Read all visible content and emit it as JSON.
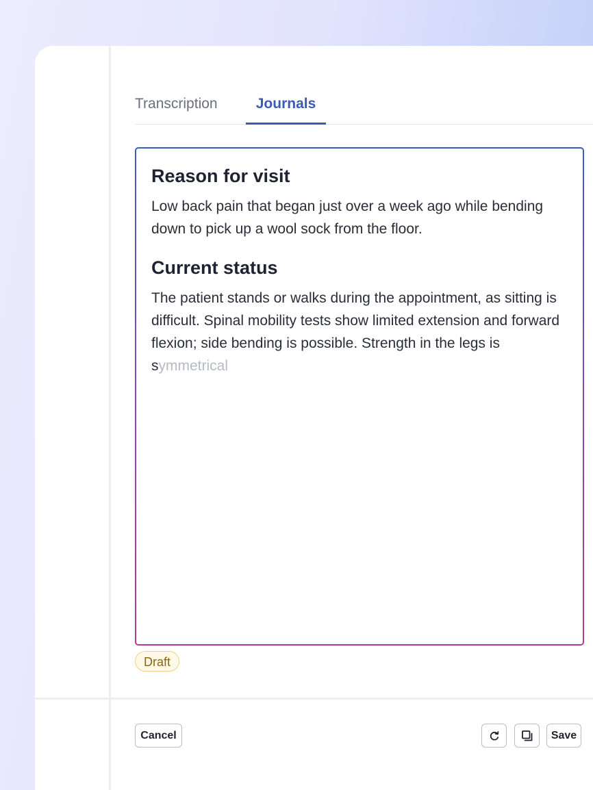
{
  "tabs": {
    "transcription": "Transcription",
    "journals": "Journals",
    "active": "journals"
  },
  "journal": {
    "sections": [
      {
        "heading": "Reason for visit",
        "body": "Low back pain that began just over a week ago while bending down to pick up a wool sock from the floor."
      },
      {
        "heading": "Current status",
        "body": "The patient stands or walks during the appointment, as sitting is difficult. Spinal mobility tests show limited extension and forward flexion; side bending is possible. Strength in the legs is s",
        "suggestion": "ymmetrical"
      }
    ]
  },
  "status": {
    "badge": "Draft"
  },
  "footer": {
    "cancel_label": "Cancel",
    "save_label": "Save",
    "refresh_icon": "refresh-icon",
    "copy_icon": "copy-icon"
  },
  "colors": {
    "accent": "#3a5bb5",
    "gradient_top": "#3b5bbd",
    "gradient_bottom": "#b03c8a",
    "draft_text": "#8a6513",
    "draft_border": "#f0d183"
  }
}
